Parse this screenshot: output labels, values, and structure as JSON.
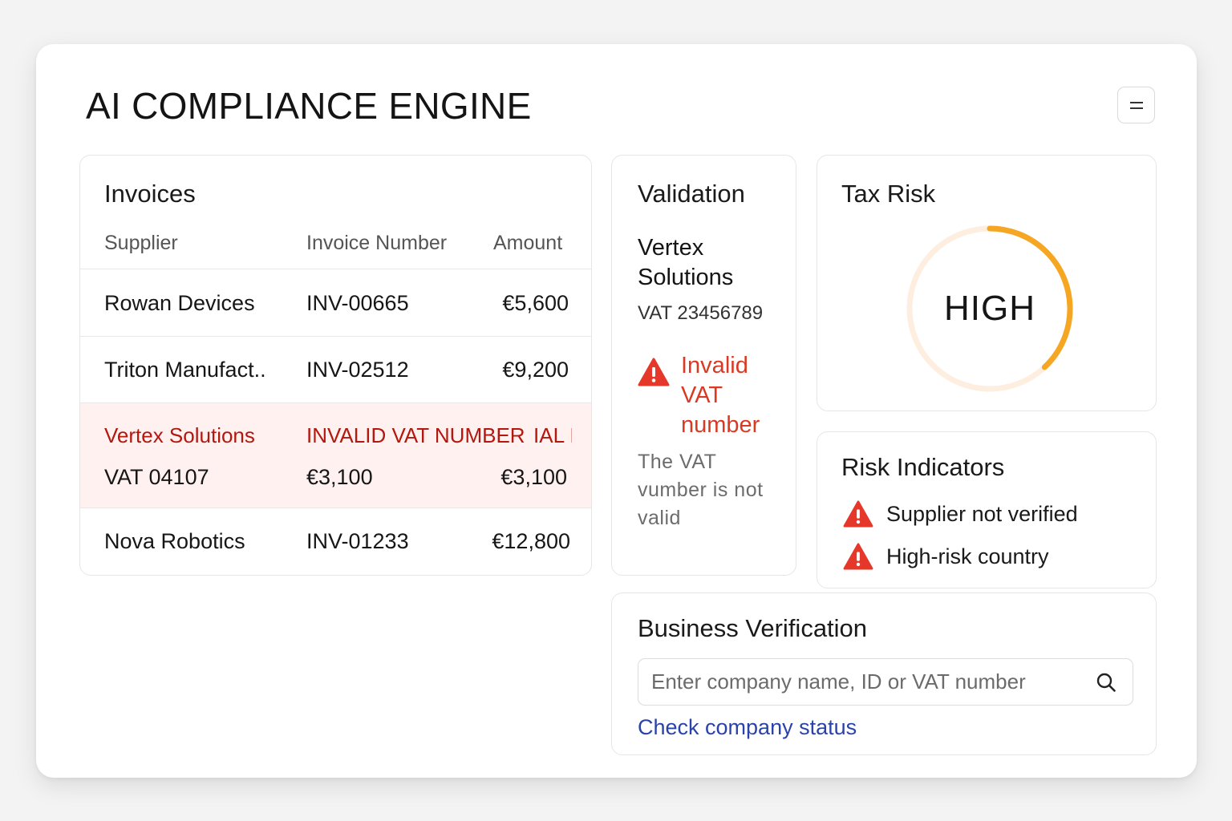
{
  "app": {
    "title": "AI COMPLIANCE ENGINE"
  },
  "colors": {
    "accent_orange": "#f5a623",
    "error_red": "#d93a24",
    "link_blue": "#2a43a8",
    "flag_row_bg": "#fff1f0"
  },
  "invoices": {
    "title": "Invoices",
    "columns": [
      "Supplier",
      "Invoice Number",
      "Amount"
    ],
    "rows": [
      {
        "supplier": "Rowan Devices",
        "invoice_number": "INV-00665",
        "amount": "€5,600"
      },
      {
        "supplier": "Triton Manufact..",
        "invoice_number": "INV-02512",
        "amount": "€9,200"
      },
      {
        "supplier": "Vertex Solutions",
        "invoice_number": "INVALID VAT NUMBER",
        "amount": "IAL I",
        "vat": "VAT 04107",
        "amount_2": "€3,100",
        "amount_3": "€3,100",
        "flagged": true
      },
      {
        "supplier": "Nova Robotics",
        "invoice_number": "INV-01233",
        "amount": "€12,800"
      }
    ]
  },
  "validation": {
    "title": "Validation",
    "company": "Vertex Solutions",
    "vat": "VAT 23456789",
    "error_title": "Invalid VAT number",
    "error_desc": "The VAT vumber is not valid",
    "icon": "warning-icon"
  },
  "tax_risk": {
    "title": "Tax Risk",
    "level": "HIGH",
    "gauge_fraction": 0.38
  },
  "risk_indicators": {
    "title": "Risk Indicators",
    "items": [
      {
        "label": "Supplier not verified",
        "icon": "warning-icon"
      },
      {
        "label": "High-risk country",
        "icon": "warning-icon"
      }
    ]
  },
  "business_verification": {
    "title": "Business Verification",
    "search_placeholder": "Enter company name, ID or VAT number",
    "search_value": "",
    "link_label": "Check company status"
  }
}
